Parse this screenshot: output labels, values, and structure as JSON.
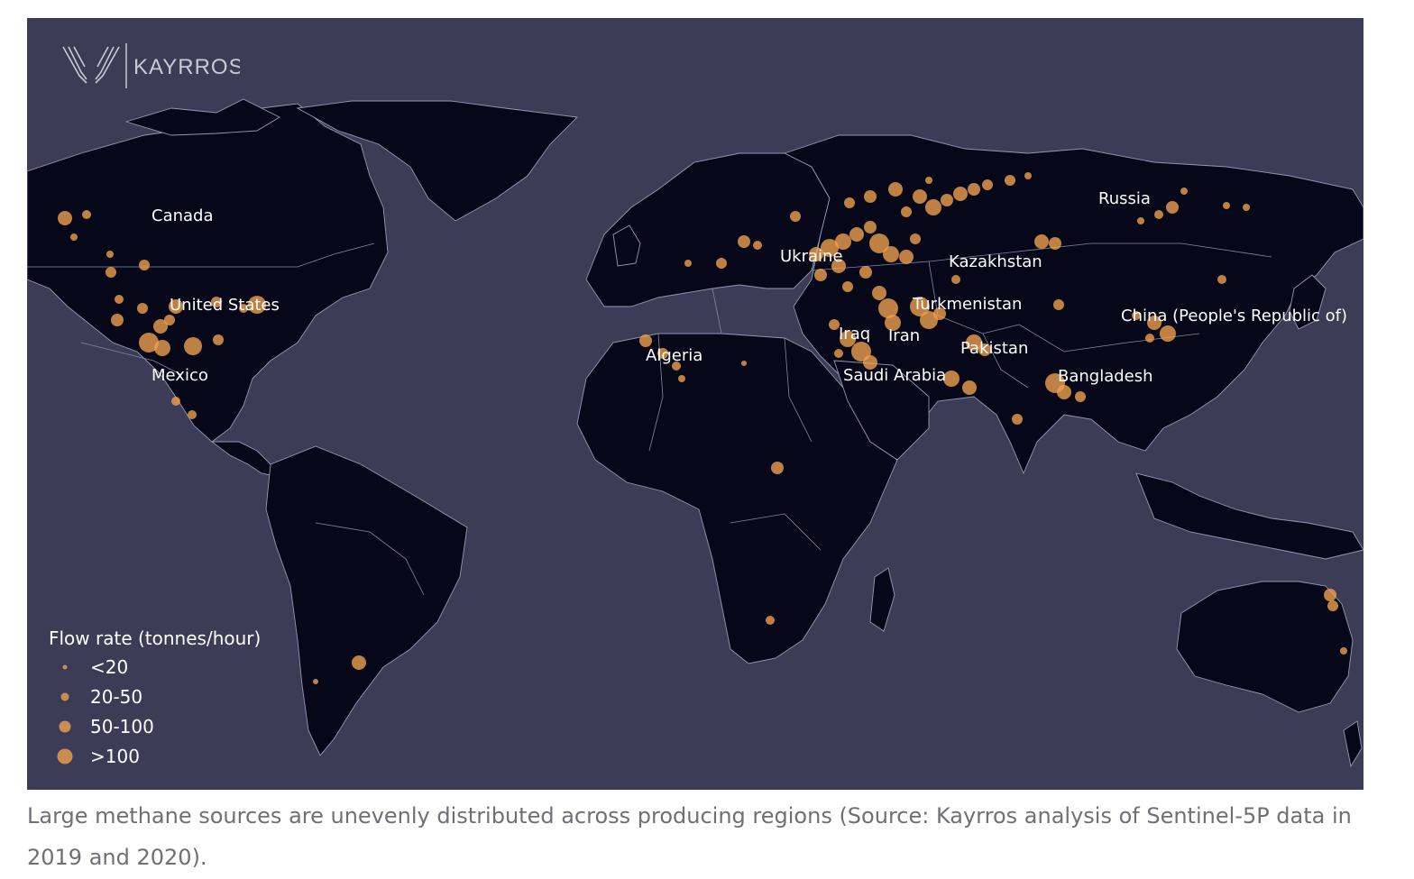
{
  "brand": {
    "name": "KAYRROS",
    "logo_icon": "kayrros-wing-logo-icon"
  },
  "map": {
    "background_color": "#3d3c57",
    "land_color": "#07071a",
    "source_color": "#f4a34f",
    "country_labels": [
      "Canada",
      "United States",
      "Mexico",
      "Algeria",
      "Ukraine",
      "Kazakhstan",
      "Russia",
      "Turkmenistan",
      "Iraq",
      "Iran",
      "Saudi Arabia",
      "Pakistan",
      "Bangladesh",
      "China (People's Republic of)"
    ]
  },
  "legend": {
    "title": "Flow rate (tonnes/hour)",
    "items": [
      {
        "label": "<20"
      },
      {
        "label": "20-50"
      },
      {
        "label": "50-100"
      },
      {
        "label": ">100"
      }
    ]
  },
  "caption": "Large methane sources are unevenly distributed across producing regions (Source: Kayrros analysis of Sentinel-5P data in 2019 and 2020)."
}
